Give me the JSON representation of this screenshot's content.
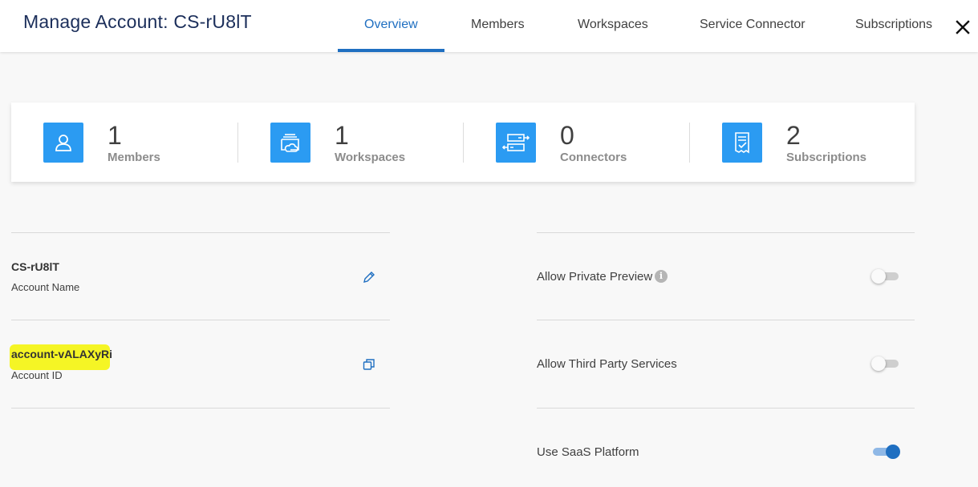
{
  "header": {
    "title": "Manage Account: CS-rU8lT",
    "tabs": [
      {
        "label": "Overview",
        "active": true
      },
      {
        "label": "Members",
        "active": false
      },
      {
        "label": "Workspaces",
        "active": false
      },
      {
        "label": "Service Connector",
        "active": false
      },
      {
        "label": "Subscriptions",
        "active": false
      }
    ]
  },
  "stats": [
    {
      "value": "1",
      "label": "Members",
      "icon": "user-icon"
    },
    {
      "value": "1",
      "label": "Workspaces",
      "icon": "workspace-cloud-icon"
    },
    {
      "value": "0",
      "label": "Connectors",
      "icon": "connector-icon"
    },
    {
      "value": "2",
      "label": "Subscriptions",
      "icon": "subscription-receipt-icon"
    }
  ],
  "account": {
    "name_value": "CS-rU8lT",
    "name_label": "Account Name",
    "id_value": "account-vALAXyRi",
    "id_label": "Account ID"
  },
  "options": [
    {
      "label": "Allow Private Preview",
      "enabled": false
    },
    {
      "label": "Allow Third Party Services",
      "enabled": false
    },
    {
      "label": "Use SaaS Platform",
      "enabled": true
    }
  ],
  "colors": {
    "accent": "#1f6fc1",
    "stat_icon_bg": "#2b9bf2",
    "title": "#1b2e5a",
    "highlight": "#f5f500"
  }
}
